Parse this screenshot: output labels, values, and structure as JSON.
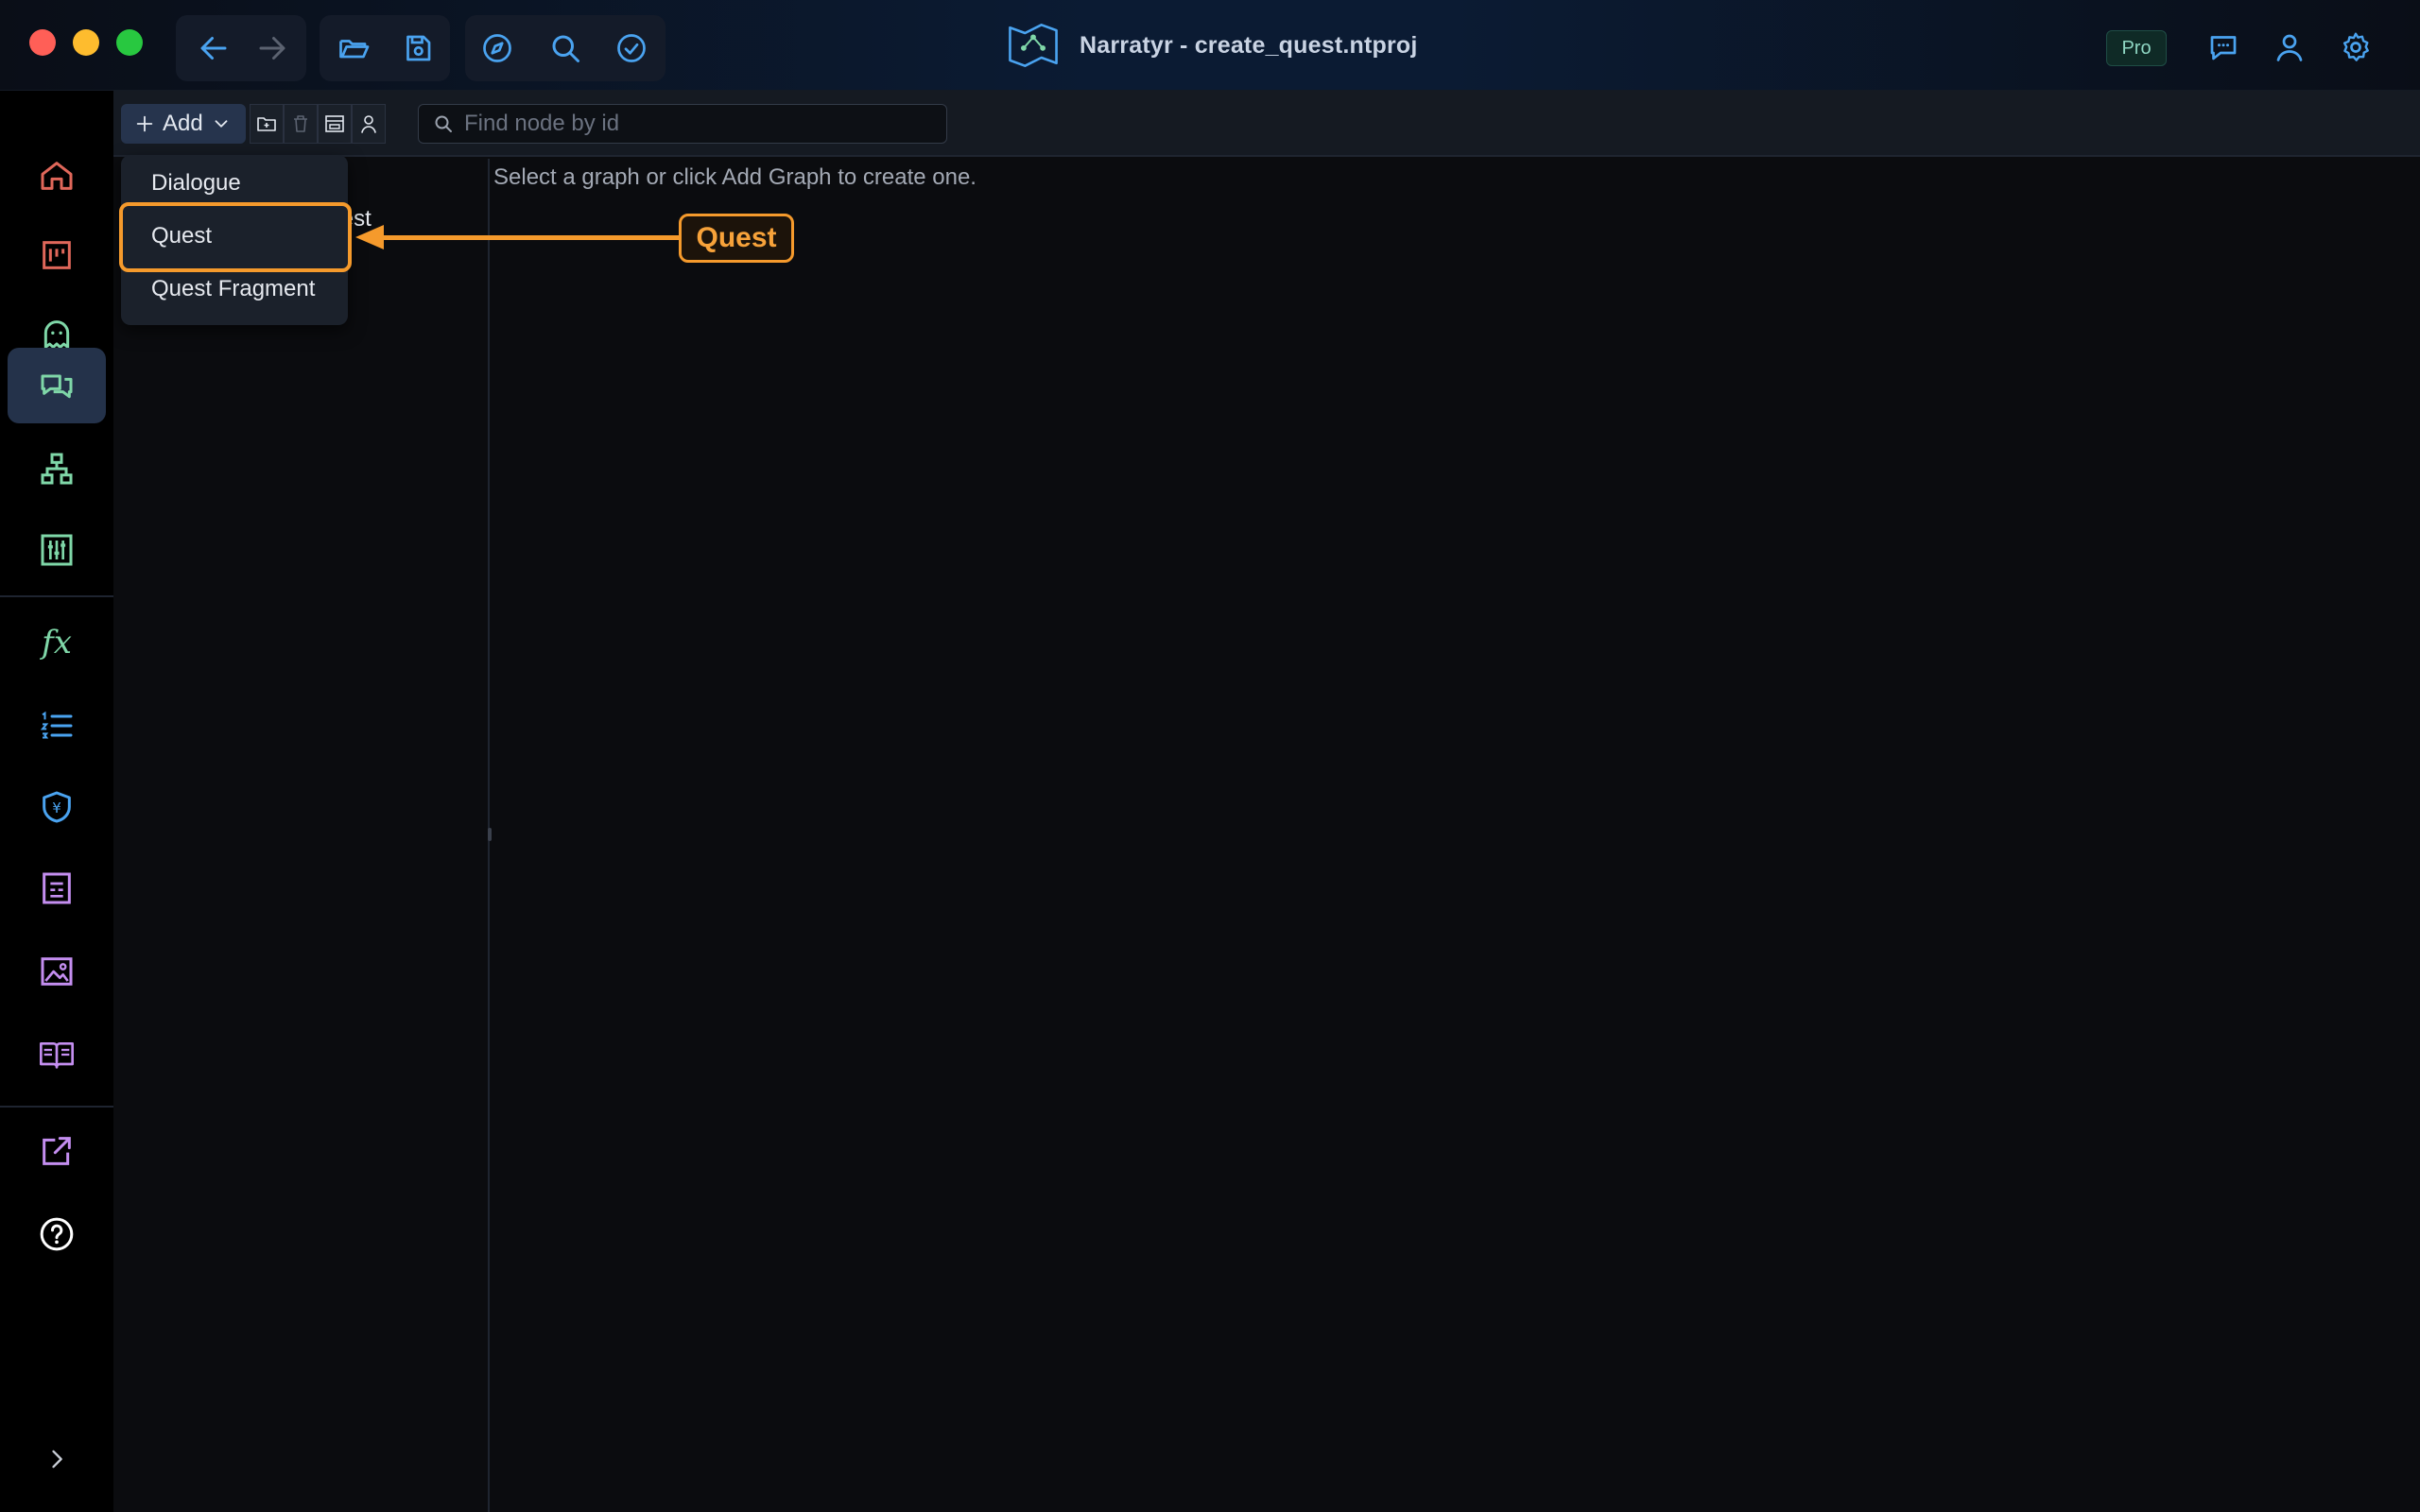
{
  "window": {
    "title": "Narratyr - create_quest.ntproj",
    "badge": "Pro"
  },
  "titlebar": {
    "left_buttons": [
      "back-arrow-icon",
      "forward-arrow-icon",
      "folder-open-icon",
      "save-icon",
      "compass-icon",
      "search-icon",
      "check-circle-icon"
    ],
    "right_buttons": [
      "chat-icon",
      "user-icon",
      "gear-icon"
    ]
  },
  "sidebar": {
    "items": [
      {
        "icon": "home-icon",
        "active": false
      },
      {
        "icon": "board-icon",
        "active": false
      },
      {
        "icon": "ghost-icon",
        "active": false
      },
      {
        "icon": "dialogue-icon",
        "active": true
      },
      {
        "icon": "hierarchy-icon",
        "active": false
      },
      {
        "icon": "sliders-icon",
        "active": false
      },
      {
        "icon": "function-icon",
        "label": "fx",
        "active": false
      },
      {
        "icon": "numbered-list-icon",
        "active": false
      },
      {
        "icon": "currency-shield-icon",
        "active": false
      },
      {
        "icon": "document-icon",
        "active": false
      },
      {
        "icon": "image-icon",
        "active": false
      },
      {
        "icon": "book-icon",
        "active": false
      },
      {
        "icon": "export-icon",
        "active": false
      },
      {
        "icon": "help-icon",
        "active": false
      }
    ],
    "collapse_icon": "chevron-right-icon"
  },
  "toolbar": {
    "add_label": "Add",
    "search_placeholder": "Find node by id"
  },
  "graph_list": {
    "items": [
      {
        "label": "FactionQuest"
      }
    ]
  },
  "main": {
    "empty_message": "Select a graph or click Add Graph to create one."
  },
  "add_menu": {
    "items": [
      {
        "label": "Dialogue"
      },
      {
        "label": "Quest",
        "highlighted": true
      },
      {
        "label": "Quest Fragment"
      }
    ]
  },
  "annotation": {
    "label": "Quest",
    "color": "#f59a2c"
  },
  "colors": {
    "accent": "#f59a2c",
    "nav_active": "#24324a",
    "icon_blue": "#4aa3f0",
    "icon_green": "#7fd7a8",
    "icon_purple": "#c48ef0"
  }
}
